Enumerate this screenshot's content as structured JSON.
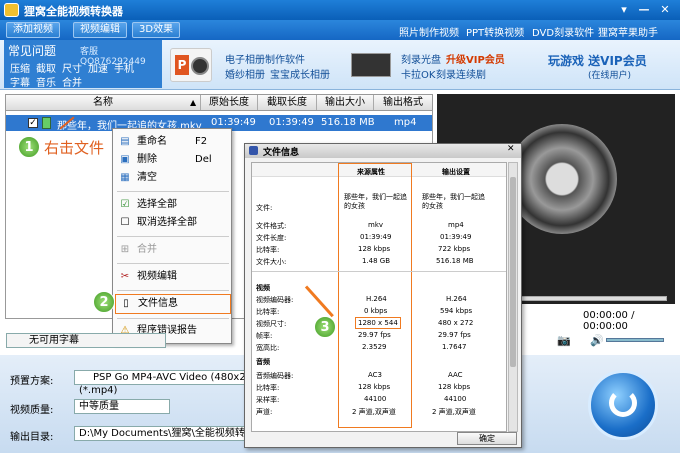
{
  "app": {
    "title": "狸窝全能视频转换器"
  },
  "toolbar": {
    "add_video": "添加视频",
    "video_edit": "视频编辑",
    "effect_3d": "3D效果"
  },
  "top_links": [
    "照片制作视频",
    "PPT转换视频",
    "DVD刻录软件",
    "狸窝苹果助手"
  ],
  "faq": {
    "title": "常见问题",
    "qq": "客服QQ876292449",
    "row1": [
      "压缩",
      "截取",
      "尺寸",
      "加速",
      "手机"
    ],
    "row2": [
      "字幕",
      "音乐",
      "合并"
    ]
  },
  "ads": {
    "a1": "电子相册制作软件",
    "a2": "婚纱相册",
    "a3": "宝宝成长相册",
    "b1": "刻录光盘",
    "b2": "升级VIP会员",
    "b3": "卡拉OK",
    "b4": "刻录连续剧",
    "c1": "玩游戏 送VIP会员",
    "c2": "(在线用户)"
  },
  "list": {
    "headers": [
      "名称",
      "原始长度",
      "截取长度",
      "输出大小",
      "输出格式"
    ],
    "rows": [
      {
        "name": "那些年，我们一起追的女孩.mkv",
        "orig": "01:39:49",
        "cut": "01:39:49",
        "size": "516.18 MB",
        "fmt": "mp4"
      }
    ]
  },
  "annotations": {
    "n1": "1",
    "n2": "2",
    "n3": "3",
    "right_click": "右击文件"
  },
  "context_menu": [
    {
      "icon": "rename-icon",
      "label": "重命名",
      "key": "F2"
    },
    {
      "icon": "delete-icon",
      "label": "删除",
      "key": "Del"
    },
    {
      "icon": "clear-icon",
      "label": "清空",
      "key": ""
    },
    {
      "icon": "check-icon",
      "label": "选择全部",
      "key": ""
    },
    {
      "icon": "uncheck-icon",
      "label": "取消选择全部",
      "key": ""
    },
    {
      "icon": "merge-icon",
      "label": "合并",
      "key": ""
    },
    {
      "icon": "scissors-icon",
      "label": "视频编辑",
      "key": ""
    },
    {
      "icon": "file-info-icon",
      "label": "文件信息",
      "key": ""
    },
    {
      "icon": "warning-icon",
      "label": "程序错误报告",
      "key": ""
    }
  ],
  "dialog": {
    "title": "文件信息",
    "col_source": "来源属性",
    "col_output": "输出设置",
    "rows": [
      {
        "k": "文件:",
        "s": "那些年，我们一起追的女孩",
        "o": "那些年，我们一起追的女孩"
      },
      {
        "k": "文件格式:",
        "s": "mkv",
        "o": "mp4"
      },
      {
        "k": "文件长度:",
        "s": "01:39:49",
        "o": "01:39:49"
      },
      {
        "k": "比特率:",
        "s": "128 kbps",
        "o": "722 kbps"
      },
      {
        "k": "文件大小:",
        "s": "1.48 GB",
        "o": "516.18 MB"
      }
    ],
    "video_section": "视频",
    "video_rows": [
      {
        "k": "视频编码器:",
        "s": "H.264",
        "o": "H.264"
      },
      {
        "k": "比特率:",
        "s": "0 kbps",
        "o": "594 kbps"
      },
      {
        "k": "视频尺寸:",
        "s": "1280 x 544",
        "o": "480 x 272"
      },
      {
        "k": "帧率:",
        "s": "29.97 fps",
        "o": "29.97 fps"
      },
      {
        "k": "宽高比:",
        "s": "2.3529",
        "o": "1.7647"
      }
    ],
    "audio_section": "音频",
    "audio_rows": [
      {
        "k": "音频编码器:",
        "s": "AC3",
        "o": "AAC"
      },
      {
        "k": "比特率:",
        "s": "128 kbps",
        "o": "128 kbps"
      },
      {
        "k": "采样率:",
        "s": "44100",
        "o": "44100"
      },
      {
        "k": "声道:",
        "s": "2 声道,双声道",
        "o": "2 声道,双声道"
      }
    ],
    "ok": "确定"
  },
  "preview": {
    "time": "00:00:00 / 00:00:00"
  },
  "subtitle": {
    "value": "无可用字幕"
  },
  "bottom": {
    "preset_label": "预置方案:",
    "preset_value": "PSP Go MP4-AVC Video (480x272)(*.mp4)",
    "quality_label": "视频质量:",
    "quality_value": "中等质量",
    "output_label": "输出目录:",
    "output_value": "D:\\My Documents\\狸窝\\全能视频转换器"
  }
}
